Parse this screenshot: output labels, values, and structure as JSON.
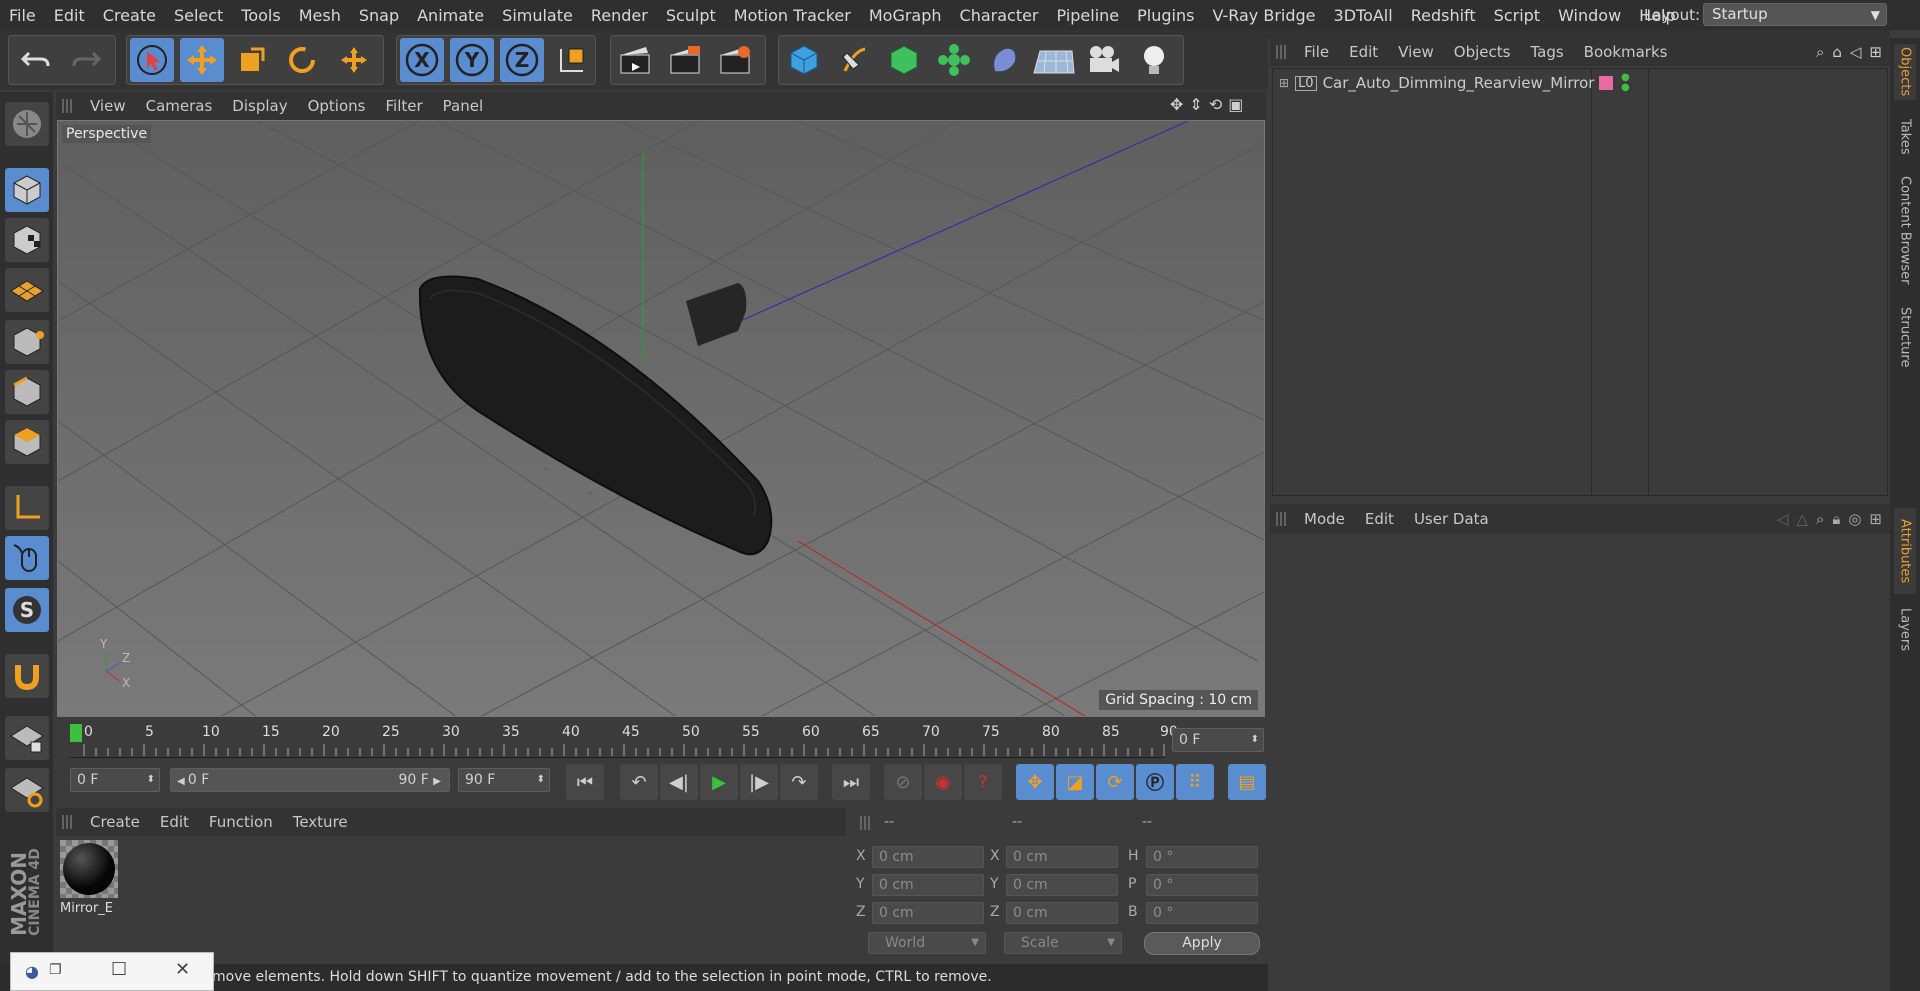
{
  "menubar": {
    "items": [
      "File",
      "Edit",
      "Create",
      "Select",
      "Tools",
      "Mesh",
      "Snap",
      "Animate",
      "Simulate",
      "Render",
      "Sculpt",
      "Motion Tracker",
      "MoGraph",
      "Character",
      "Pipeline",
      "Plugins",
      "V-Ray Bridge",
      "3DToAll",
      "Redshift",
      "Script",
      "Window",
      "Help"
    ],
    "layout_label": "Layout:",
    "layout_value": "Startup"
  },
  "toolbar": {
    "axis_x": "X",
    "axis_y": "Y",
    "axis_z": "Z"
  },
  "viewport": {
    "menu": [
      "View",
      "Cameras",
      "Display",
      "Options",
      "Filter",
      "Panel"
    ],
    "camera_label": "Perspective",
    "grid_spacing": "Grid Spacing : 10 cm",
    "axis_labels": {
      "y": "Y",
      "z": "Z",
      "x": "X"
    }
  },
  "timeline": {
    "ticks": [
      "0",
      "5",
      "10",
      "15",
      "20",
      "25",
      "30",
      "35",
      "40",
      "45",
      "50",
      "55",
      "60",
      "65",
      "70",
      "75",
      "80",
      "85",
      "90"
    ],
    "current_frame": "0 F",
    "start_frame": "0 F",
    "range_start": "0 F",
    "range_end": "90 F",
    "end_frame": "90 F"
  },
  "materials": {
    "menu": [
      "Create",
      "Edit",
      "Function",
      "Texture"
    ],
    "items": [
      {
        "name": "Mirror_E"
      }
    ]
  },
  "coordinates": {
    "headers": [
      "--",
      "--",
      "--"
    ],
    "rows": [
      {
        "l1": "X",
        "v1": "0 cm",
        "l2": "X",
        "v2": "0 cm",
        "l3": "H",
        "v3": "0 °"
      },
      {
        "l1": "Y",
        "v1": "0 cm",
        "l2": "Y",
        "v2": "0 cm",
        "l3": "P",
        "v3": "0 °"
      },
      {
        "l1": "Z",
        "v1": "0 cm",
        "l2": "Z",
        "v2": "0 cm",
        "l3": "B",
        "v3": "0 °"
      }
    ],
    "mode_world": "World",
    "mode_scale": "Scale",
    "apply_label": "Apply"
  },
  "status": {
    "text": "move elements. Hold down SHIFT to quantize movement / add to the selection in point mode, CTRL to remove."
  },
  "objects": {
    "menu": [
      "File",
      "Edit",
      "View",
      "Objects",
      "Tags",
      "Bookmarks"
    ],
    "tree": [
      {
        "name": "Car_Auto_Dimming_Rearview_Mirror",
        "tag_color": "#e86aa0"
      }
    ]
  },
  "attributes": {
    "menu": [
      "Mode",
      "Edit",
      "User Data"
    ]
  },
  "side_tabs": {
    "top": [
      "Objects",
      "Takes",
      "Content Browser",
      "Structure"
    ],
    "bottom": [
      "Attributes",
      "Layers"
    ]
  },
  "brand": {
    "line1": "MAXON",
    "line2": "CINEMA 4D"
  },
  "colors": {
    "accent": "#5a8cd0",
    "active_tab": "#e8a030",
    "play": "#3ec03e"
  }
}
